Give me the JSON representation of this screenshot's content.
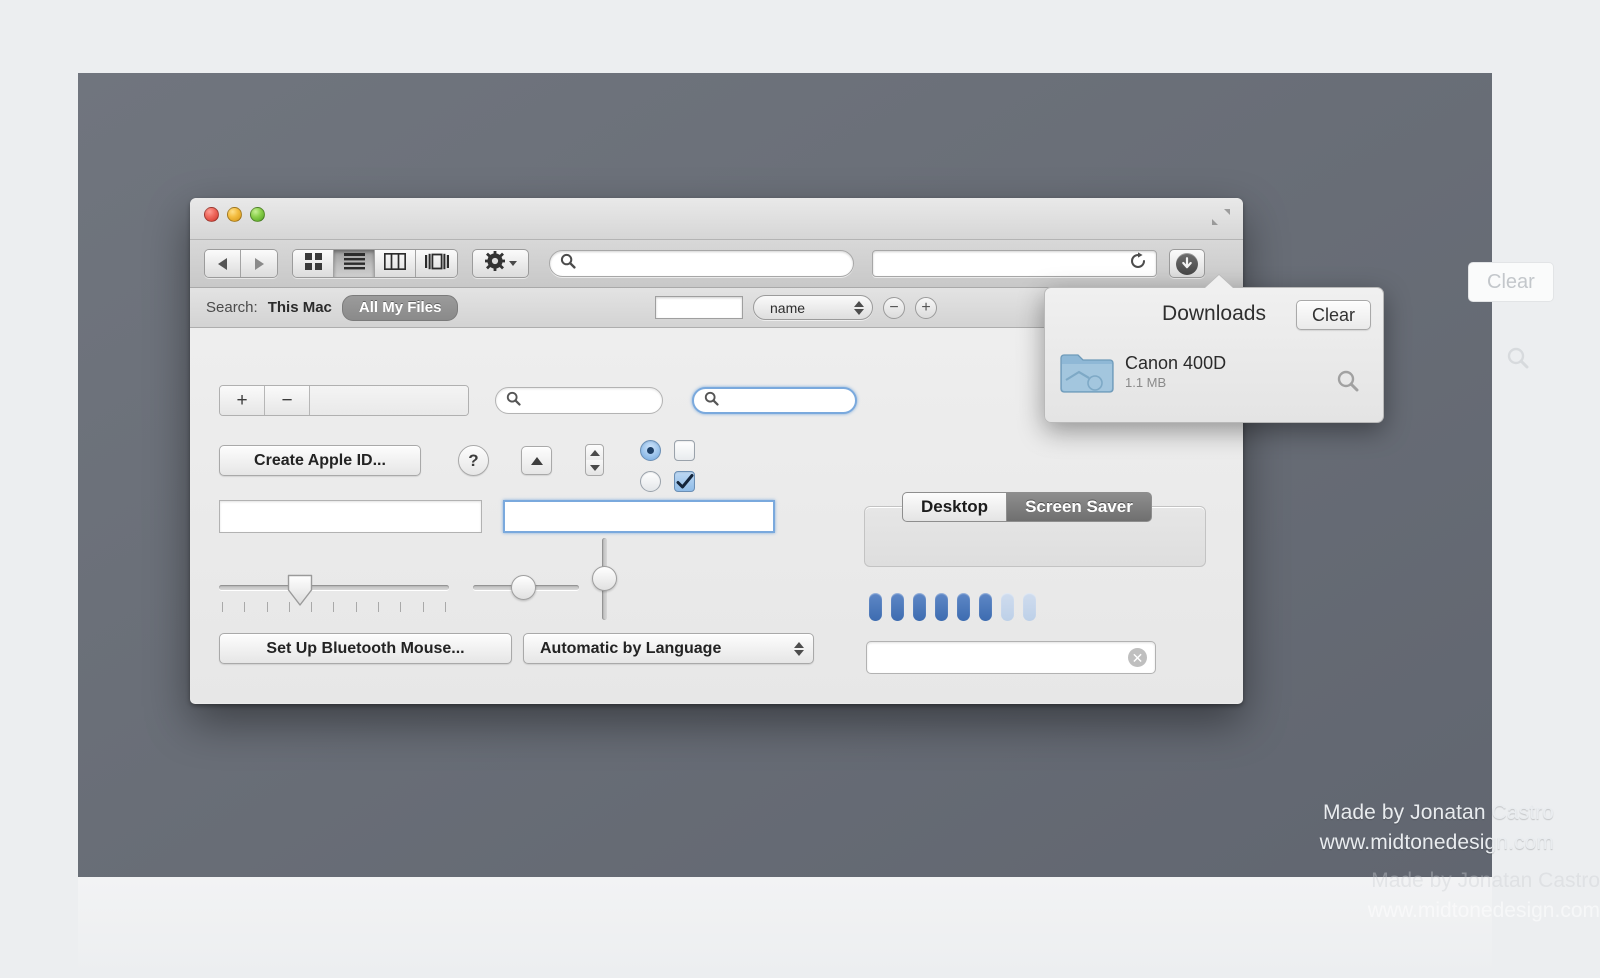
{
  "window": {
    "traffic_lights": [
      "close",
      "minimize",
      "zoom"
    ],
    "fullscreen_icon": "fullscreen-expand-icon"
  },
  "toolbar": {
    "back_icon": "back-arrow-icon",
    "forward_icon": "forward-arrow-icon",
    "view_modes": [
      {
        "id": "icon-view",
        "icon": "grid-icon",
        "selected": false
      },
      {
        "id": "list-view",
        "icon": "list-icon",
        "selected": true
      },
      {
        "id": "column-view",
        "icon": "columns-icon",
        "selected": false
      },
      {
        "id": "coverflow-view",
        "icon": "coverflow-icon",
        "selected": false
      }
    ],
    "action_menu": {
      "icon": "gear-icon",
      "caret": "chevron-down-icon"
    },
    "search": {
      "value": "",
      "placeholder": "",
      "icon": "search-icon"
    },
    "url_field": {
      "value": "",
      "placeholder": "",
      "reload_icon": "reload-icon"
    },
    "downloads_button": {
      "icon": "download-arrow-icon"
    }
  },
  "scopebar": {
    "label": "Search:",
    "scope_this_mac": "This Mac",
    "scope_all_files": "All My Files",
    "criteria_value": "",
    "criteria_attribute": "name",
    "remove_label": "−",
    "add_label": "+"
  },
  "body": {
    "plus_label": "+",
    "minus_label": "−",
    "search_plain": {
      "value": "",
      "icon": "search-icon"
    },
    "search_focused": {
      "value": "",
      "icon": "search-icon"
    },
    "create_apple_id_button": "Create Apple ID...",
    "help_button": "?",
    "disclosure_button": "disclosure-triangle-icon",
    "stepper": "stepper-control",
    "radio_selected": true,
    "radio_unselected": false,
    "checkbox_unchecked": false,
    "checkbox_checked": true,
    "checkmark": "✔",
    "textfield_plain": {
      "value": ""
    },
    "textfield_focused": {
      "value": ""
    },
    "slider_ticks": {
      "value": 35,
      "min": 0,
      "max": 100,
      "tick_count": 11
    },
    "slider_round": {
      "value": 45,
      "min": 0,
      "max": 100
    },
    "slider_vertical": {
      "value": 50,
      "min": 0,
      "max": 100
    },
    "bluetooth_button": "Set Up Bluetooth Mouse...",
    "language_dropdown": {
      "selected": "Automatic by Language"
    },
    "tabs": [
      {
        "label": "Desktop",
        "selected": true
      },
      {
        "label": "Screen Saver",
        "selected": false
      }
    ],
    "level_indicator": {
      "total": 8,
      "filled": 6
    },
    "clear_field": {
      "value": "",
      "clear_icon": "clear-x-icon"
    }
  },
  "downloads_popover": {
    "title": "Downloads",
    "clear_button": "Clear",
    "magnify_icon": "magnify-icon",
    "items": [
      {
        "icon": "folder-icon",
        "name": "Canon 400D",
        "size": "1.1 MB"
      }
    ]
  },
  "ghost": {
    "clear_button": "Clear",
    "magnify_icon": "magnify-icon"
  },
  "credits": {
    "line1": "Made by Jonatan Castro",
    "line2": "www.midtonedesign.com"
  },
  "colors": {
    "backdrop": "#6b7079",
    "accent_blue": "#3d6cb0",
    "focus_blue": "#7aa9dd",
    "traffic_red": "#ef6a5e",
    "traffic_yellow": "#f4bd41",
    "traffic_green": "#8bd04c"
  }
}
